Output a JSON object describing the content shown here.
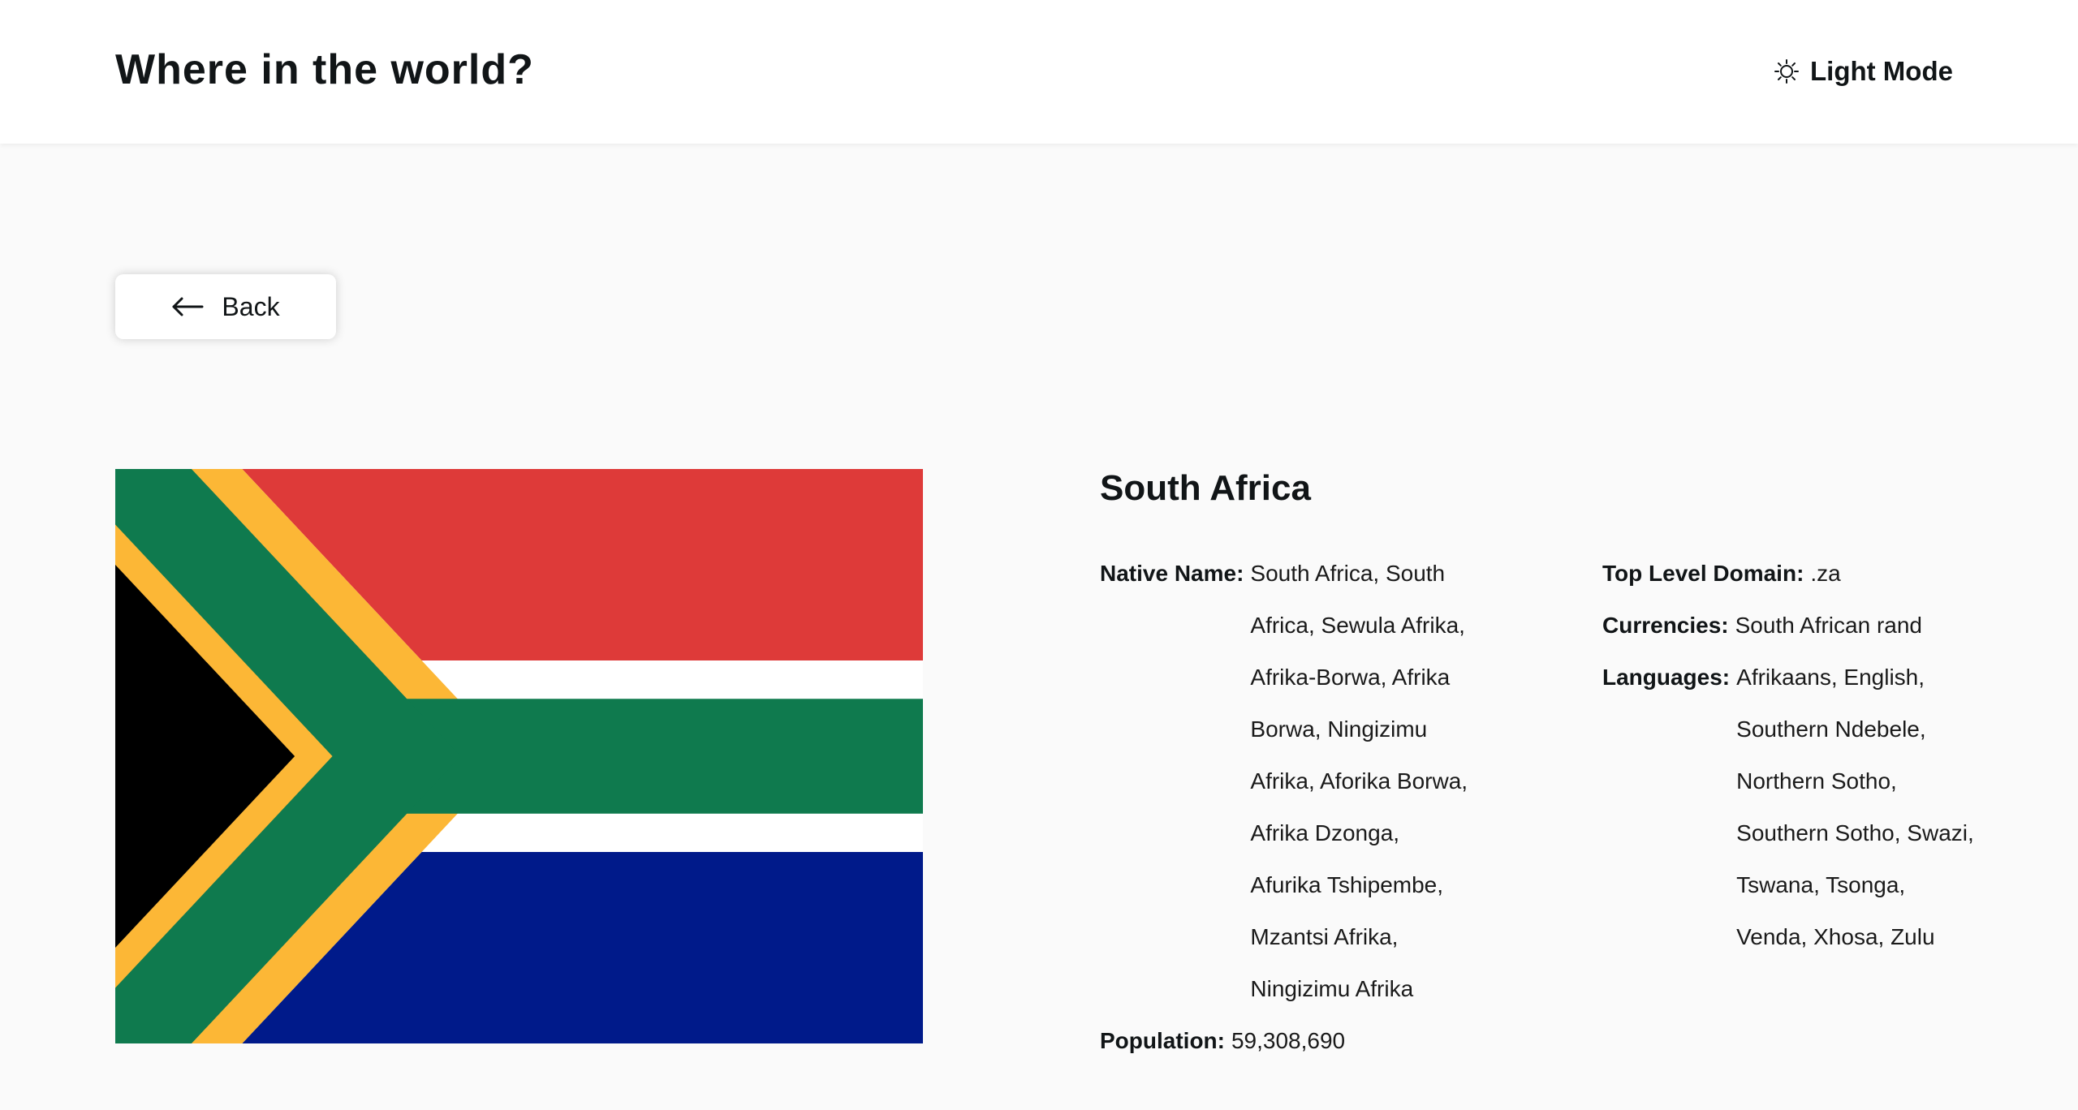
{
  "header": {
    "title": "Where in the world?",
    "theme_toggle_label": "Light Mode",
    "theme_icon": "sun-icon"
  },
  "navigation": {
    "back_label": "Back",
    "back_icon": "arrow-left-icon"
  },
  "country": {
    "name": "South Africa",
    "flag_icon": "south-africa-flag",
    "flag_colors": {
      "red": "#de3a39",
      "white": "#ffffff",
      "green": "#0f7a4e",
      "gold": "#fcb736",
      "black": "#000000",
      "blue": "#001a8a"
    },
    "details_left": {
      "native_name_label": "Native Name:",
      "native_name_value": "South Africa, South Africa, Sewula Afrika, Afrika-Borwa, Afrika Borwa, Ningizimu Afrika, Aforika Borwa, Afrika Dzonga, Afurika Tshipembe, Mzantsi Afrika, Ningizimu Afrika",
      "population_label": "Population:",
      "population_value": "59,308,690"
    },
    "details_right": {
      "tld_label": "Top Level Domain:",
      "tld_value": ".za",
      "currencies_label": "Currencies:",
      "currencies_value": "South African rand",
      "languages_label": "Languages:",
      "languages_value": "Afrikaans, English, Southern Ndebele, Northern Sotho, Southern Sotho, Swazi, Tswana, Tsonga, Venda, Xhosa, Zulu"
    }
  },
  "colors": {
    "background": "#fafafa",
    "surface": "#ffffff",
    "text": "#111517"
  }
}
